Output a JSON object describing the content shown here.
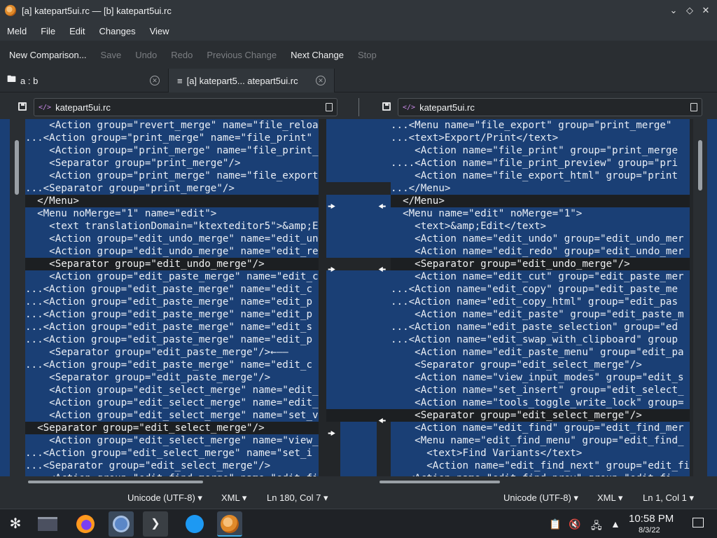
{
  "window": {
    "title": "[a] katepart5ui.rc — [b] katepart5ui.rc"
  },
  "menubar": {
    "items": [
      "Meld",
      "File",
      "Edit",
      "Changes",
      "View"
    ]
  },
  "toolbar": {
    "new_comparison": "New Comparison...",
    "save": "Save",
    "undo": "Undo",
    "redo": "Redo",
    "previous_change": "Previous Change",
    "next_change": "Next Change",
    "stop": "Stop"
  },
  "tabs": [
    {
      "label": "a : b"
    },
    {
      "label": "[a] katepart5... atepart5ui.rc"
    }
  ],
  "left_file": {
    "name": "katepart5ui.rc"
  },
  "right_file": {
    "name": "katepart5ui.rc"
  },
  "left_lines": [
    {
      "text": "    <Action group=\"revert_merge\" name=\"file_reloa",
      "kind": "changed"
    },
    {
      "text": "...<Action group=\"print_merge\" name=\"file_print\"",
      "kind": "changed"
    },
    {
      "text": "    <Action group=\"print_merge\" name=\"file_print_",
      "kind": "changed"
    },
    {
      "text": "    <Separator group=\"print_merge\"/>",
      "kind": "changed"
    },
    {
      "text": "    <Action group=\"print_merge\" name=\"file_export",
      "kind": "changed"
    },
    {
      "text": "...<Separator group=\"print_merge\"/>",
      "kind": "changed"
    },
    {
      "text": "  </Menu>",
      "kind": "sep"
    },
    {
      "text": "  <Menu noMerge=\"1\" name=\"edit\">",
      "kind": "changed"
    },
    {
      "text": "    <text translationDomain=\"ktexteditor5\">&amp;E",
      "kind": "changed"
    },
    {
      "text": "    <Action group=\"edit_undo_merge\" name=\"edit_un",
      "kind": "changed"
    },
    {
      "text": "    <Action group=\"edit_undo_merge\" name=\"edit_re",
      "kind": "changed"
    },
    {
      "text": "    <Separator group=\"edit_undo_merge\"/>",
      "kind": "sep"
    },
    {
      "text": "    <Action group=\"edit_paste_merge\" name=\"edit_c",
      "kind": "changed"
    },
    {
      "text": "...<Action group=\"edit_paste_merge\" name=\"edit_c",
      "kind": "changed"
    },
    {
      "text": "...<Action group=\"edit_paste_merge\" name=\"edit_p",
      "kind": "changed"
    },
    {
      "text": "...<Action group=\"edit_paste_merge\" name=\"edit_p",
      "kind": "changed"
    },
    {
      "text": "...<Action group=\"edit_paste_merge\" name=\"edit_s",
      "kind": "changed"
    },
    {
      "text": "...<Action group=\"edit_paste_merge\" name=\"edit_p",
      "kind": "changed"
    },
    {
      "text": "    <Separator group=\"edit_paste_merge\"/>←——",
      "kind": "changed"
    },
    {
      "text": "...<Action group=\"edit_paste_merge\" name=\"edit_c",
      "kind": "changed"
    },
    {
      "text": "    <Separator group=\"edit_paste_merge\"/>",
      "kind": "changed"
    },
    {
      "text": "    <Action group=\"edit_select_merge\" name=\"edit_",
      "kind": "changed"
    },
    {
      "text": "    <Action group=\"edit_select_merge\" name=\"edit_",
      "kind": "changed"
    },
    {
      "text": "    <Action group=\"edit_select_merge\" name=\"set_v",
      "kind": "changed"
    },
    {
      "text": "  <Separator group=\"edit_select_merge\"/>",
      "kind": "sep"
    },
    {
      "text": "    <Action group=\"edit_select_merge\" name=\"view_",
      "kind": "changed"
    },
    {
      "text": "...<Action group=\"edit_select_merge\" name=\"set_i",
      "kind": "changed"
    },
    {
      "text": "...<Separator group=\"edit_select_merge\"/>",
      "kind": "changed"
    },
    {
      "text": "    <Action group=\"edit_find_merge\" name=\"edit_fi",
      "kind": "changed"
    }
  ],
  "right_lines": [
    {
      "text": "...<Menu name=\"file_export\" group=\"print_merge\"",
      "kind": "changed"
    },
    {
      "text": "...<text>Export/Print</text>",
      "kind": "changed"
    },
    {
      "text": "    <Action name=\"file_print\" group=\"print_merge",
      "kind": "changed"
    },
    {
      "text": "....<Action name=\"file_print_preview\" group=\"pri",
      "kind": "changed"
    },
    {
      "text": "    <Action name=\"file_export_html\" group=\"print",
      "kind": "changed"
    },
    {
      "text": "...</Menu>",
      "kind": "changed"
    },
    {
      "text": "  </Menu>",
      "kind": "sep"
    },
    {
      "text": "  <Menu name=\"edit\" noMerge=\"1\">",
      "kind": "changed"
    },
    {
      "text": "    <text>&amp;Edit</text>",
      "kind": "changed"
    },
    {
      "text": "    <Action name=\"edit_undo\" group=\"edit_undo_mer",
      "kind": "changed"
    },
    {
      "text": "    <Action name=\"edit_redo\" group=\"edit_undo_mer",
      "kind": "changed"
    },
    {
      "text": "    <Separator group=\"edit_undo_merge\"/>",
      "kind": "sep"
    },
    {
      "text": "    <Action name=\"edit_cut\" group=\"edit_paste_mer",
      "kind": "changed"
    },
    {
      "text": "...<Action name=\"edit_copy\" group=\"edit_paste_me",
      "kind": "changed"
    },
    {
      "text": "...<Action name=\"edit_copy_html\" group=\"edit_pas",
      "kind": "changed"
    },
    {
      "text": "    <Action name=\"edit_paste\" group=\"edit_paste_m",
      "kind": "changed"
    },
    {
      "text": "...<Action name=\"edit_paste_selection\" group=\"ed",
      "kind": "changed"
    },
    {
      "text": "...<Action name=\"edit_swap_with_clipboard\" group",
      "kind": "changed"
    },
    {
      "text": "    <Action name=\"edit_paste_menu\" group=\"edit_pa",
      "kind": "changed"
    },
    {
      "text": "    <Separator group=\"edit_select_merge\"/>",
      "kind": "changed"
    },
    {
      "text": "    <Action name=\"view_input_modes\" group=\"edit_s",
      "kind": "changed"
    },
    {
      "text": "    <Action name=\"set_insert\" group=\"edit_select_",
      "kind": "changed"
    },
    {
      "text": "    <Action name=\"tools_toggle_write_lock\" group=",
      "kind": "changed"
    },
    {
      "text": "    <Separator group=\"edit_select_merge\"/>",
      "kind": "sep"
    },
    {
      "text": "    <Action name=\"edit_find\" group=\"edit_find_mer",
      "kind": "changed"
    },
    {
      "text": "    <Menu name=\"edit_find_menu\" group=\"edit_find_",
      "kind": "changed"
    },
    {
      "text": "      <text>Find Variants</text>",
      "kind": "changed"
    },
    {
      "text": "      <Action name=\"edit_find_next\" group=\"edit_fi",
      "kind": "changed"
    },
    {
      "text": "...<Action name=\"edit_find_prev\" group=\"edit_fi",
      "kind": "changed"
    }
  ],
  "status_left": {
    "encoding": "Unicode (UTF-8)",
    "syntax": "XML",
    "position": "Ln 180, Col 7"
  },
  "status_right": {
    "encoding": "Unicode (UTF-8)",
    "syntax": "XML",
    "position": "Ln 1, Col 1"
  },
  "taskbar": {
    "time": "10:58 PM",
    "date": "8/3/22"
  },
  "colors": {
    "changed": "#1a3f75",
    "accent": "#3daee9"
  }
}
